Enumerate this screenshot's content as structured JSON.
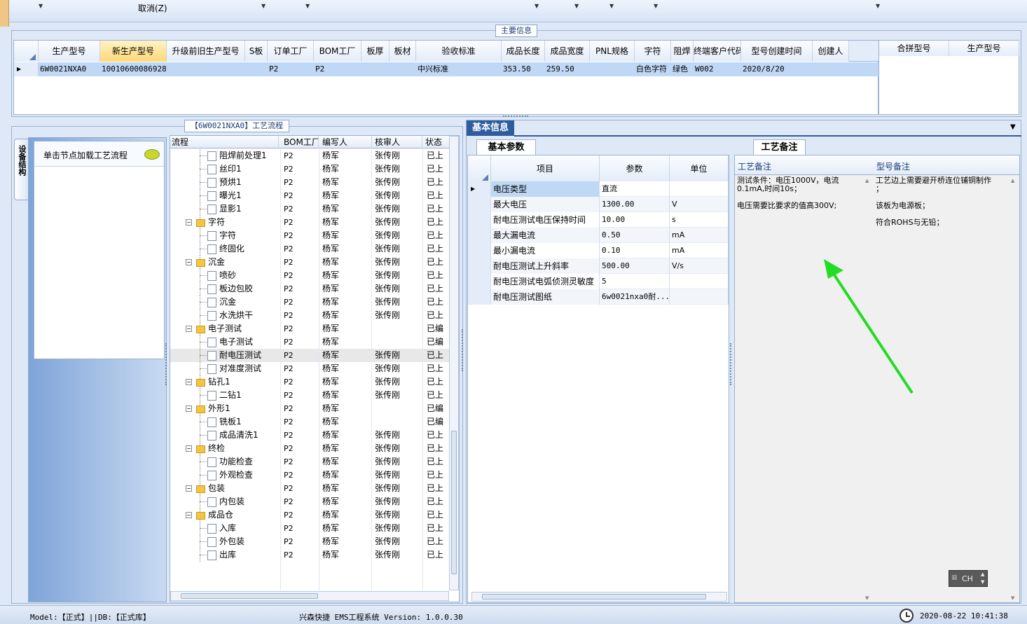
{
  "toolbar": {
    "cancel_label": "取消(Z)"
  },
  "main_info": {
    "group_label": "主要信息",
    "columns": [
      "生产型号",
      "新生产型号",
      "升级前旧生产型号",
      "S板",
      "订单工厂",
      "BOM工厂",
      "板厚",
      "板材",
      "验收标准",
      "成品长度",
      "成品宽度",
      "PNL规格",
      "字符",
      "阻焊",
      "终端客户代码",
      "型号创建时间",
      "创建人"
    ],
    "row": [
      "6W0021NXA0",
      "10010600086928",
      "",
      "",
      "P2",
      "P2",
      "",
      "",
      "中兴标准",
      "353.50",
      "259.50",
      "",
      "白色字符",
      "绿色",
      "W002",
      "2020/8/20",
      ""
    ],
    "side_columns": [
      "合拼型号",
      "生产型号"
    ]
  },
  "flow": {
    "group_label": "【6W0021NXA0】工艺流程",
    "side_tab": "设备结构",
    "side_hint": "单击节点加载工艺流程",
    "columns": [
      "流程",
      "BOM工厂",
      "编写人",
      "核审人",
      "状态"
    ],
    "rows": [
      {
        "name": "阻焊前处理1",
        "level": 1,
        "bom": "P2",
        "writer": "杨军",
        "reviewer": "张传刚",
        "status": "已上"
      },
      {
        "name": "丝印1",
        "level": 1,
        "bom": "P2",
        "writer": "杨军",
        "reviewer": "张传刚",
        "status": "已上"
      },
      {
        "name": "预烘1",
        "level": 1,
        "bom": "P2",
        "writer": "杨军",
        "reviewer": "张传刚",
        "status": "已上"
      },
      {
        "name": "曝光1",
        "level": 1,
        "bom": "P2",
        "writer": "杨军",
        "reviewer": "张传刚",
        "status": "已上"
      },
      {
        "name": "显影1",
        "level": 1,
        "bom": "P2",
        "writer": "杨军",
        "reviewer": "张传刚",
        "status": "已上"
      },
      {
        "name": "字符",
        "level": 0,
        "bom": "P2",
        "writer": "杨军",
        "reviewer": "张传刚",
        "status": "已上"
      },
      {
        "name": "字符",
        "level": 1,
        "bom": "P2",
        "writer": "杨军",
        "reviewer": "张传刚",
        "status": "已上"
      },
      {
        "name": "终固化",
        "level": 1,
        "bom": "P2",
        "writer": "杨军",
        "reviewer": "张传刚",
        "status": "已上"
      },
      {
        "name": "沉金",
        "level": 0,
        "bom": "P2",
        "writer": "杨军",
        "reviewer": "张传刚",
        "status": "已上"
      },
      {
        "name": "喷砂",
        "level": 1,
        "bom": "P2",
        "writer": "杨军",
        "reviewer": "张传刚",
        "status": "已上"
      },
      {
        "name": "板边包胶",
        "level": 1,
        "bom": "P2",
        "writer": "杨军",
        "reviewer": "张传刚",
        "status": "已上"
      },
      {
        "name": "沉金",
        "level": 1,
        "bom": "P2",
        "writer": "杨军",
        "reviewer": "张传刚",
        "status": "已上"
      },
      {
        "name": "水洗烘干",
        "level": 1,
        "bom": "P2",
        "writer": "杨军",
        "reviewer": "张传刚",
        "status": "已上"
      },
      {
        "name": "电子测试",
        "level": 0,
        "bom": "P2",
        "writer": "杨军",
        "reviewer": "",
        "status": "已编"
      },
      {
        "name": "电子测试",
        "level": 1,
        "bom": "P2",
        "writer": "杨军",
        "reviewer": "",
        "status": "已编"
      },
      {
        "name": "耐电压测试",
        "level": 1,
        "bom": "P2",
        "writer": "杨军",
        "reviewer": "张传刚",
        "status": "已上",
        "selected": true
      },
      {
        "name": "对准度测试",
        "level": 1,
        "bom": "P2",
        "writer": "杨军",
        "reviewer": "张传刚",
        "status": "已上"
      },
      {
        "name": "钻孔1",
        "level": 0,
        "bom": "P2",
        "writer": "杨军",
        "reviewer": "张传刚",
        "status": "已上"
      },
      {
        "name": "二钻1",
        "level": 1,
        "bom": "P2",
        "writer": "杨军",
        "reviewer": "张传刚",
        "status": "已上"
      },
      {
        "name": "外形1",
        "level": 0,
        "bom": "P2",
        "writer": "杨军",
        "reviewer": "",
        "status": "已编"
      },
      {
        "name": "铣板1",
        "level": 1,
        "bom": "P2",
        "writer": "杨军",
        "reviewer": "",
        "status": "已编"
      },
      {
        "name": "成品清洗1",
        "level": 1,
        "bom": "P2",
        "writer": "杨军",
        "reviewer": "张传刚",
        "status": "已上"
      },
      {
        "name": "终检",
        "level": 0,
        "bom": "P2",
        "writer": "杨军",
        "reviewer": "张传刚",
        "status": "已上"
      },
      {
        "name": "功能检查",
        "level": 1,
        "bom": "P2",
        "writer": "杨军",
        "reviewer": "张传刚",
        "status": "已上"
      },
      {
        "name": "外观检查",
        "level": 1,
        "bom": "P2",
        "writer": "杨军",
        "reviewer": "张传刚",
        "status": "已上"
      },
      {
        "name": "包装",
        "level": 0,
        "bom": "P2",
        "writer": "杨军",
        "reviewer": "张传刚",
        "status": "已上"
      },
      {
        "name": "内包装",
        "level": 1,
        "bom": "P2",
        "writer": "杨军",
        "reviewer": "张传刚",
        "status": "已上"
      },
      {
        "name": "成品仓",
        "level": 0,
        "bom": "P2",
        "writer": "杨军",
        "reviewer": "张传刚",
        "status": "已上"
      },
      {
        "name": "入库",
        "level": 1,
        "bom": "P2",
        "writer": "杨军",
        "reviewer": "张传刚",
        "status": "已上"
      },
      {
        "name": "外包装",
        "level": 1,
        "bom": "P2",
        "writer": "杨军",
        "reviewer": "张传刚",
        "status": "已上"
      },
      {
        "name": "出库",
        "level": 1,
        "bom": "P2",
        "writer": "杨军",
        "reviewer": "张传刚",
        "status": "已上"
      }
    ]
  },
  "basic": {
    "tab_label": "基本信息",
    "params_tab": "基本参数",
    "columns": [
      "项目",
      "参数",
      "单位"
    ],
    "rows": [
      {
        "item": "电压类型",
        "value": "直流",
        "unit": ""
      },
      {
        "item": "最大电压",
        "value": "1300.00",
        "unit": "V"
      },
      {
        "item": "耐电压测试电压保持时间",
        "value": "10.00",
        "unit": "s"
      },
      {
        "item": "最大漏电流",
        "value": "0.50",
        "unit": "mA"
      },
      {
        "item": "最小漏电流",
        "value": "0.10",
        "unit": "mA"
      },
      {
        "item": "耐电压测试上升斜率",
        "value": "500.00",
        "unit": "V/s"
      },
      {
        "item": "耐电压测试电弧侦测灵敏度",
        "value": "5",
        "unit": ""
      },
      {
        "item": "耐电压测试图纸",
        "value": "6w0021nxa0耐...",
        "unit": ""
      }
    ]
  },
  "notes": {
    "tab_label": "工艺备注",
    "process_header": "工艺备注",
    "model_header": "型号备注",
    "process_lines": [
      "测试条件：电压1000V，电流",
      "0.1mA,时间10s；",
      "",
      "电压需要比要求的值高300V;"
    ],
    "model_lines": [
      "工艺边上需要避开桥连位铺铜制作",
      "；",
      "",
      "该板为电源板；",
      "",
      "符合ROHS与无铅；"
    ],
    "ime_label": "CH"
  },
  "status": {
    "model_db": "Model:【正式】||DB:【正式库】",
    "app": "兴森快捷 EMS工程系统 Version: 1.0.0.30",
    "datetime": "2020-08-22 10:41:38"
  }
}
